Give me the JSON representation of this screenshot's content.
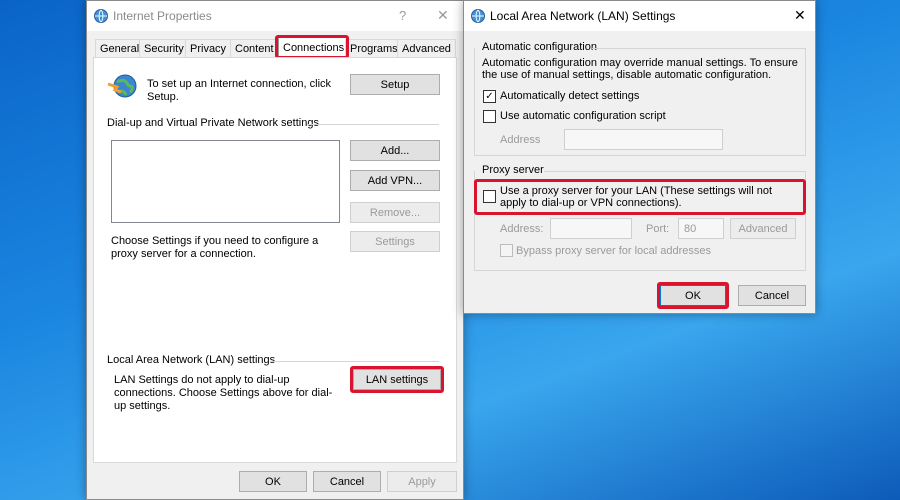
{
  "internet_properties": {
    "title": "Internet Properties",
    "help_glyph": "?",
    "close_glyph": "✕",
    "tabs": [
      "General",
      "Security",
      "Privacy",
      "Content",
      "Connections",
      "Programs",
      "Advanced"
    ],
    "setup_text": "To set up an Internet connection, click Setup.",
    "setup_button": "Setup",
    "dialup_group": "Dial-up and Virtual Private Network settings",
    "add_button": "Add...",
    "add_vpn_button": "Add VPN...",
    "remove_button": "Remove...",
    "settings_button": "Settings",
    "settings_text": "Choose Settings if you need to configure a proxy server for a connection.",
    "lan_group": "Local Area Network (LAN) settings",
    "lan_text": "LAN Settings do not apply to dial-up connections. Choose Settings above for dial-up settings.",
    "lan_button": "LAN settings",
    "ok_button": "OK",
    "cancel_button": "Cancel",
    "apply_button": "Apply"
  },
  "lan_dialog": {
    "title": "Local Area Network (LAN) Settings",
    "close_glyph": "✕",
    "auto_group": "Automatic configuration",
    "auto_desc": "Automatic configuration may override manual settings.  To ensure the use of manual settings, disable automatic configuration.",
    "auto_detect_label": "Automatically detect settings",
    "auto_detect_checked": true,
    "use_script_label": "Use automatic configuration script",
    "use_script_checked": false,
    "address_label": "Address",
    "proxy_group": "Proxy server",
    "use_proxy_label": "Use a proxy server for your LAN (These settings will not apply to dial-up or VPN connections).",
    "use_proxy_checked": false,
    "proxy_address_label": "Address:",
    "port_label": "Port:",
    "port_value": "80",
    "advanced_button": "Advanced",
    "bypass_label": "Bypass proxy server for local addresses",
    "ok_button": "OK",
    "cancel_button": "Cancel"
  }
}
